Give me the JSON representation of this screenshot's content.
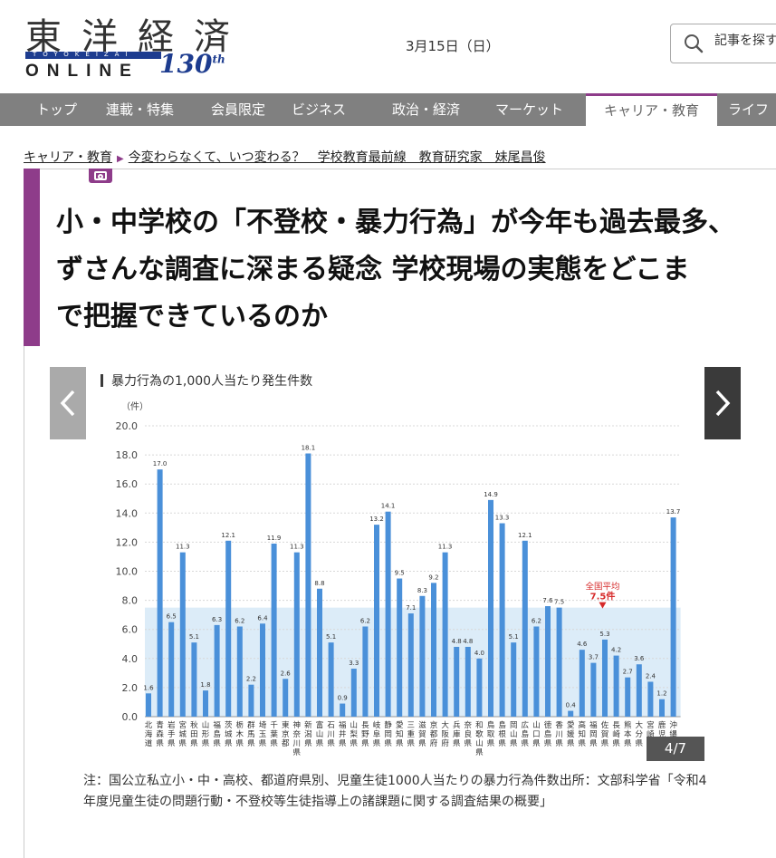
{
  "header": {
    "logo": {
      "title": "東洋経済",
      "sub": "TOYOKEIZAI",
      "online": "ONLINE",
      "anniv": "130",
      "anniv_suffix": "th"
    },
    "date": "3月15日（日）",
    "search": {
      "placeholder": "記事を探す",
      "icon": "search-icon"
    }
  },
  "nav": {
    "items": [
      "トップ",
      "連載・特集",
      "会員限定",
      "ビジネス",
      "政治・経済",
      "マーケット",
      "キャリア・教育",
      "ライフ"
    ],
    "active": "キャリア・教育"
  },
  "breadcrumb": {
    "section": "キャリア・教育",
    "series": "今変わらなくて、いつ変わる？　学校教育最前線　教育研究家　妹尾昌俊"
  },
  "headline": {
    "lines": [
      "小・中学校の「不登校・暴力行為」が今年も過去最多、",
      "ずさんな調査に深まる疑念 学校現場の実態をどこま",
      "で把握できているのか"
    ]
  },
  "gallery": {
    "counter": "4/7"
  },
  "chart_data": {
    "type": "bar",
    "title": "暴力行為の1,000人当たり発生件数",
    "ylabel": "（件）",
    "ylim": [
      0,
      20
    ],
    "yticks": [
      "0.0",
      "2.0",
      "4.0",
      "6.0",
      "8.0",
      "10.0",
      "12.0",
      "14.0",
      "16.0",
      "18.0",
      "20.0"
    ],
    "categories": [
      "北海道",
      "青森県",
      "岩手県",
      "宮城県",
      "秋田県",
      "山形県",
      "福島県",
      "茨城県",
      "栃木県",
      "群馬県",
      "埼玉県",
      "千葉県",
      "東京都",
      "神奈川県",
      "新潟県",
      "富山県",
      "石川県",
      "福井県",
      "山梨県",
      "長野県",
      "岐阜県",
      "静岡県",
      "愛知県",
      "三重県",
      "滋賀県",
      "京都府",
      "大阪府",
      "兵庫県",
      "奈良県",
      "和歌山県",
      "鳥取県",
      "島根県",
      "岡山県",
      "広島県",
      "山口県",
      "徳島県",
      "香川県",
      "愛媛県",
      "高知県",
      "福岡県",
      "佐賀県",
      "長崎県",
      "熊本県",
      "大分県",
      "宮崎県",
      "鹿児島県",
      "沖縄県"
    ],
    "values": [
      1.6,
      17.0,
      6.5,
      11.3,
      5.1,
      1.8,
      6.3,
      12.1,
      6.2,
      2.2,
      6.4,
      11.9,
      2.6,
      11.3,
      18.1,
      8.8,
      5.1,
      0.9,
      3.3,
      6.2,
      13.2,
      14.1,
      9.5,
      7.1,
      8.3,
      9.2,
      11.3,
      4.8,
      4.8,
      4.0,
      14.9,
      13.3,
      5.1,
      12.1,
      6.2,
      7.6,
      7.5,
      0.4,
      4.6,
      3.7,
      5.3,
      4.2,
      2.7,
      3.6,
      2.4,
      1.2,
      13.7
    ],
    "value_labels": [
      "1.6",
      "17.0",
      "6.5",
      "11.3",
      "5.1",
      "1.8",
      "6.3",
      "12.1",
      "6.2",
      "2.2",
      "6.4",
      "11.9",
      "2.6",
      "11.3",
      "18.1",
      "8.8",
      "5.1",
      "0.9",
      "3.3",
      "6.2",
      "13.2",
      "14.1",
      "9.5",
      "7.1",
      "8.3",
      "9.2",
      "11.3",
      "4.8",
      "4.8",
      "4.0",
      "14.9",
      "13.3",
      "5.1",
      "12.1",
      "6.2",
      "7.6",
      "7.5",
      "0.4",
      "4.6",
      "3.7",
      "5.3",
      "4.2",
      "2.7",
      "3.6",
      "2.4",
      "1.2",
      "13.7"
    ],
    "average": {
      "label": "全国平均",
      "value_label": "7.5件",
      "value": 7.5
    },
    "colors": {
      "bar": "#4a90d9",
      "avg_band": "#dcecf8",
      "avg_text": "#d62a2a",
      "title_mark": "#3b3b3b"
    }
  },
  "caption": "注：国公立私立小・中・高校、都道府県別、児童生徒1000人当たりの暴力行為件数出所：文部科学省「令和4年度児童生徒の問題行動・不登校等生徒指導上の諸課題に関する調査結果の概要」"
}
